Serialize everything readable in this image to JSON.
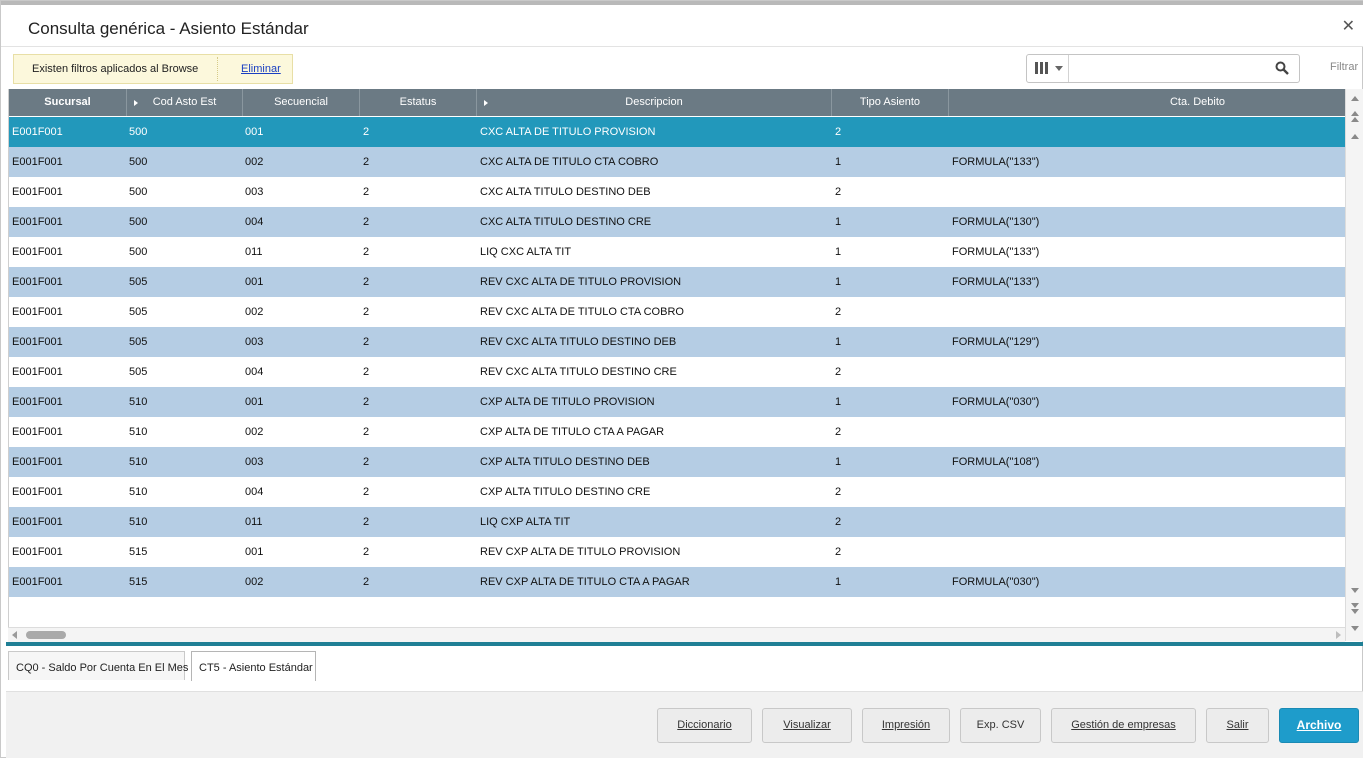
{
  "window": {
    "title": "Consulta genérica - Asiento Estándar",
    "close": "✕"
  },
  "filter": {
    "notice": "Existen filtros aplicados al Browse",
    "remove_link": "Eliminar"
  },
  "search": {
    "placeholder": "",
    "filter_label": "Filtrar",
    "columns_icon": "columns-icon",
    "search_icon": "search-icon"
  },
  "grid": {
    "columns": [
      "Sucursal",
      "Cod Asto Est",
      "Secuencial",
      "Estatus",
      "Descripcion",
      "Tipo Asiento",
      "Cta. Debito"
    ],
    "rows": [
      [
        "E001F001",
        "500",
        "001",
        "2",
        "CXC ALTA DE TITULO PROVISION",
        "2",
        ""
      ],
      [
        "E001F001",
        "500",
        "002",
        "2",
        "CXC ALTA DE TITULO CTA COBRO",
        "1",
        "FORMULA(\"133\")"
      ],
      [
        "E001F001",
        "500",
        "003",
        "2",
        "CXC ALTA TITULO DESTINO DEB",
        "2",
        ""
      ],
      [
        "E001F001",
        "500",
        "004",
        "2",
        "CXC ALTA TITULO DESTINO CRE",
        "1",
        "FORMULA(\"130\")"
      ],
      [
        "E001F001",
        "500",
        "011",
        "2",
        "LIQ CXC ALTA TIT",
        "1",
        "FORMULA(\"133\")"
      ],
      [
        "E001F001",
        "505",
        "001",
        "2",
        "REV CXC ALTA DE TITULO PROVISION",
        "1",
        "FORMULA(\"133\")"
      ],
      [
        "E001F001",
        "505",
        "002",
        "2",
        "REV CXC ALTA DE TITULO CTA COBRO",
        "2",
        ""
      ],
      [
        "E001F001",
        "505",
        "003",
        "2",
        "REV CXC ALTA TITULO DESTINO DEB",
        "1",
        "FORMULA(\"129\")"
      ],
      [
        "E001F001",
        "505",
        "004",
        "2",
        "REV CXC ALTA TITULO DESTINO CRE",
        "2",
        ""
      ],
      [
        "E001F001",
        "510",
        "001",
        "2",
        "CXP ALTA DE TITULO PROVISION",
        "1",
        "FORMULA(\"030\")"
      ],
      [
        "E001F001",
        "510",
        "002",
        "2",
        "CXP ALTA DE TITULO CTA A PAGAR",
        "2",
        ""
      ],
      [
        "E001F001",
        "510",
        "003",
        "2",
        "CXP ALTA TITULO DESTINO DEB",
        "1",
        "FORMULA(\"108\")"
      ],
      [
        "E001F001",
        "510",
        "004",
        "2",
        "CXP ALTA TITULO DESTINO CRE",
        "2",
        ""
      ],
      [
        "E001F001",
        "510",
        "011",
        "2",
        "LIQ CXP ALTA TIT",
        "2",
        ""
      ],
      [
        "E001F001",
        "515",
        "001",
        "2",
        "REV CXP ALTA DE TITULO PROVISION",
        "2",
        ""
      ],
      [
        "E001F001",
        "515",
        "002",
        "2",
        "REV CXP ALTA DE TITULO CTA A PAGAR",
        "1",
        "FORMULA(\"030\")"
      ]
    ],
    "selected_row": 0
  },
  "tabs": [
    {
      "label": "CQ0 - Saldo Por Cuenta En El Mes",
      "active": false
    },
    {
      "label": "CT5 - Asiento Estándar",
      "active": true
    }
  ],
  "buttons": {
    "diccionario": "Diccionario",
    "visualizar": "Visualizar",
    "impresion": "Impresión",
    "exp_csv": "Exp. CSV",
    "gestion": "Gestión de empresas",
    "salir": "Salir",
    "archivo": "Archivo"
  },
  "colors": {
    "header": "#6b7a84",
    "selected_row": "#2298bb",
    "alt_row": "#b5cde4",
    "primary_button": "#1e9ccb",
    "accent_line": "#1f7f95"
  }
}
